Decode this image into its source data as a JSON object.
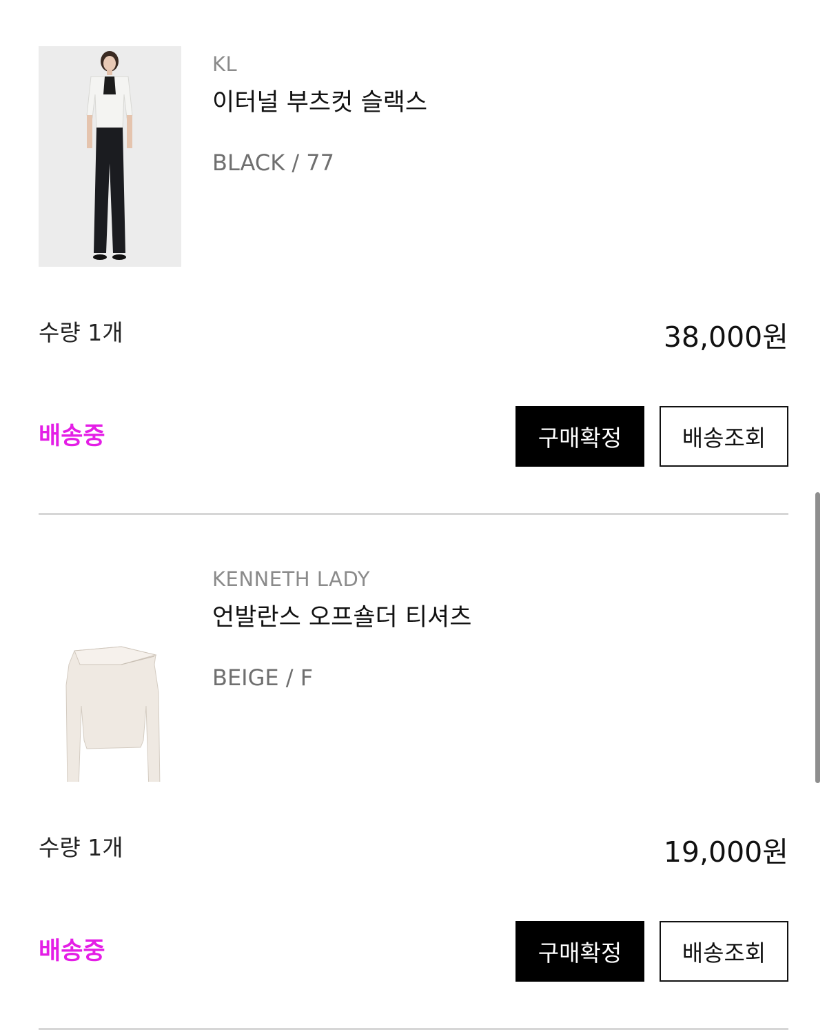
{
  "orders": [
    {
      "brand": "KL",
      "product_name": "이터널 부츠컷 슬랙스",
      "option": "BLACK / 77",
      "quantity": "수량 1개",
      "price": "38,000원",
      "status": "배송중",
      "confirm_label": "구매확정",
      "track_label": "배송조회",
      "image_icon": "model-photo-jacket-slacks"
    },
    {
      "brand": "KENNETH LADY",
      "product_name": "언발란스 오프숄더 티셔츠",
      "option": "BEIGE / F",
      "quantity": "수량 1개",
      "price": "19,000원",
      "status": "배송중",
      "confirm_label": "구매확정",
      "track_label": "배송조회",
      "image_icon": "offshoulder-top-photo"
    }
  ],
  "colors": {
    "status": "#e41ee6",
    "primary_button": "#000000",
    "divider": "#d6d6d6"
  }
}
